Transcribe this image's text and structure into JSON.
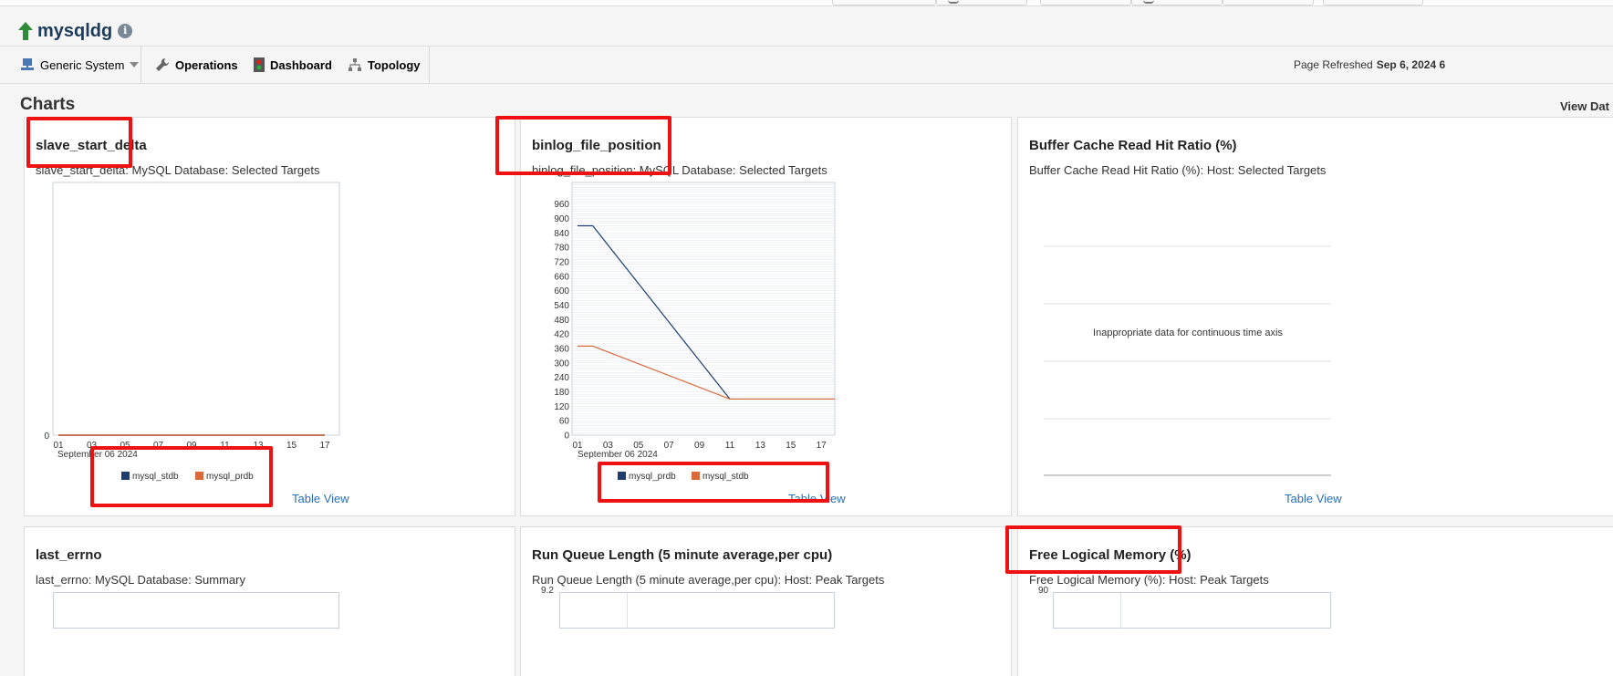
{
  "page": {
    "title": "mysqldg"
  },
  "toolbar": {
    "generic_system": "Generic System",
    "operations": "Operations",
    "dashboard": "Dashboard",
    "topology": "Topology",
    "refresh_label": "Page Refreshed",
    "refresh_value": "Sep 6, 2024 6"
  },
  "section": {
    "title": "Charts",
    "view_data": "View Dat"
  },
  "panels": [
    {
      "title": "slave_start_delta",
      "subtitle": "slave_start_delta: MySQL Database: Selected Targets",
      "table_view": "Table View"
    },
    {
      "title": "binlog_file_position",
      "subtitle": "binlog_file_position: MySQL Database: Selected Targets",
      "table_view": "Table View"
    },
    {
      "title": "Buffer Cache Read Hit Ratio (%)",
      "subtitle": "Buffer Cache Read Hit Ratio (%): Host: Selected Targets",
      "table_view": "Table View",
      "message": "Inappropriate data for continuous time axis"
    },
    {
      "title": "last_errno",
      "subtitle": "last_errno: MySQL Database: Summary"
    },
    {
      "title": "Run Queue Length (5 minute average,per cpu)",
      "subtitle": "Run Queue Length (5 minute average,per cpu): Host: Peak Targets"
    },
    {
      "title": "Free Logical Memory (%)",
      "subtitle": "Free Logical Memory (%): Host: Peak Targets"
    }
  ],
  "colors": {
    "series_navy": "#1c3d6e",
    "series_orange": "#d9683a",
    "link": "#2a6fb8",
    "highlight": "#ee1111"
  },
  "chart_data": [
    {
      "type": "line",
      "title": "slave_start_delta",
      "xlabel": "September 06 2024",
      "xticks": [
        "01",
        "03",
        "05",
        "07",
        "09",
        "11",
        "13",
        "15",
        "17"
      ],
      "yticks": [
        "0"
      ],
      "x": [
        1,
        17
      ],
      "series": [
        {
          "name": "mysql_stdb",
          "color": "#1c3d6e",
          "values": [
            0,
            0
          ]
        },
        {
          "name": "mysql_prdb",
          "color": "#d9683a",
          "values": [
            0,
            0
          ]
        }
      ],
      "legend": "bottom"
    },
    {
      "type": "line",
      "title": "binlog_file_position",
      "xlabel": "September 06 2024",
      "xticks": [
        "01",
        "03",
        "05",
        "07",
        "09",
        "11",
        "13",
        "15",
        "17"
      ],
      "yticks": [
        "0",
        "60",
        "120",
        "180",
        "240",
        "300",
        "360",
        "420",
        "480",
        "540",
        "600",
        "660",
        "720",
        "780",
        "840",
        "900",
        "960"
      ],
      "ylim": [
        0,
        1050
      ],
      "xlim": [
        1,
        18
      ],
      "series": [
        {
          "name": "mysql_prdb",
          "color": "#1c3d6e",
          "x": [
            1,
            2,
            11,
            18
          ],
          "values": [
            870,
            870,
            150,
            150
          ]
        },
        {
          "name": "mysql_stdb",
          "color": "#d9683a",
          "x": [
            1,
            2,
            11,
            18
          ],
          "values": [
            370,
            370,
            150,
            150
          ]
        }
      ],
      "legend": "bottom"
    },
    {
      "type": "line",
      "title": "Buffer Cache Read Hit Ratio (%)",
      "series": [],
      "grid": true
    },
    {
      "type": "line",
      "title": "last_errno",
      "series": []
    },
    {
      "type": "line",
      "title": "Run Queue Length (5 minute average,per cpu)",
      "yticks": [
        "9.2"
      ],
      "series": []
    },
    {
      "type": "line",
      "title": "Free Logical Memory (%)",
      "yticks": [
        "90"
      ],
      "series": []
    }
  ]
}
